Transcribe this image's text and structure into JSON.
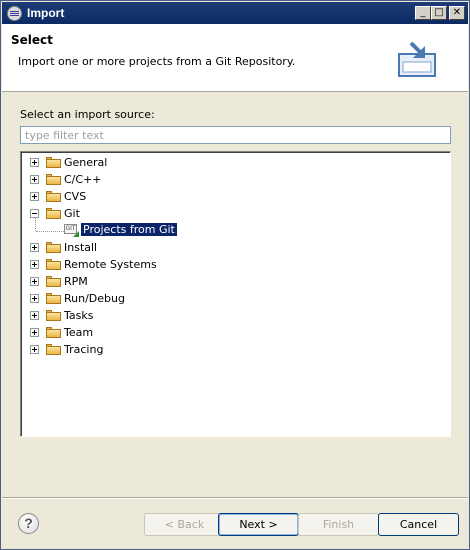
{
  "window": {
    "title": "Import",
    "icon": "eclipse-icon",
    "controls": {
      "minimize": "_",
      "maximize": "□",
      "close": "✕"
    }
  },
  "header": {
    "title": "Select",
    "description": "Import one or more projects from a Git Repository.",
    "banner_icon": "import-wizard-icon"
  },
  "source": {
    "label": "Select an import source:",
    "filter_placeholder": "type filter text",
    "filter_value": ""
  },
  "tree": {
    "items": [
      {
        "label": "General",
        "expanded": false
      },
      {
        "label": "C/C++",
        "expanded": false
      },
      {
        "label": "CVS",
        "expanded": false
      },
      {
        "label": "Git",
        "expanded": true,
        "children": [
          {
            "label": "Projects from Git",
            "selected": true
          }
        ]
      },
      {
        "label": "Install",
        "expanded": false
      },
      {
        "label": "Remote Systems",
        "expanded": false
      },
      {
        "label": "RPM",
        "expanded": false
      },
      {
        "label": "Run/Debug",
        "expanded": false
      },
      {
        "label": "Tasks",
        "expanded": false
      },
      {
        "label": "Team",
        "expanded": false
      },
      {
        "label": "Tracing",
        "expanded": false
      }
    ]
  },
  "buttons": {
    "help": "?",
    "back": "< Back",
    "next": "Next >",
    "finish": "Finish",
    "cancel": "Cancel"
  },
  "colors": {
    "title_bar": "#0b2a63",
    "selection": "#0a246a",
    "folder": "#e8b946"
  }
}
